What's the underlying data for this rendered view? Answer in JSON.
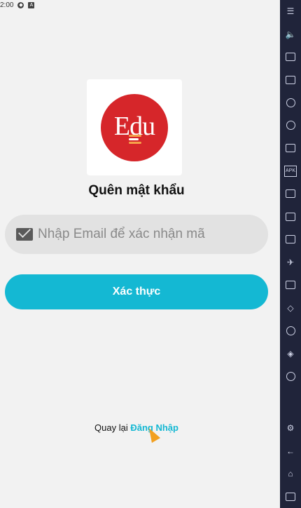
{
  "statusbar": {
    "time": "2:00"
  },
  "app": {
    "logo_text": "Edu",
    "title": "Quên mật khẩu",
    "email_placeholder": "Nhập Email để xác nhận mã",
    "verify_label": "Xác thực",
    "back_prefix": "Quay lại",
    "back_link": "Đăng Nhập"
  },
  "colors": {
    "accent": "#14b8d3",
    "logo_red": "#d6262a",
    "sidebar_bg": "#20243a"
  },
  "emulator_sidebar": {
    "top_icons": [
      "menu-icon",
      "volume-icon",
      "pointer-icon",
      "keyboard-icon",
      "play-icon",
      "rotate-icon",
      "toolbar-icon",
      "apk-icon",
      "screenshot-icon",
      "fullscreen-icon",
      "folder-icon",
      "airplane-icon",
      "copy-icon",
      "erase-icon",
      "location-icon",
      "layers-icon",
      "speed-icon"
    ],
    "bottom_icons": [
      "settings-icon",
      "back-icon",
      "home-icon",
      "recent-apps-icon"
    ],
    "apk_label": "APK"
  }
}
